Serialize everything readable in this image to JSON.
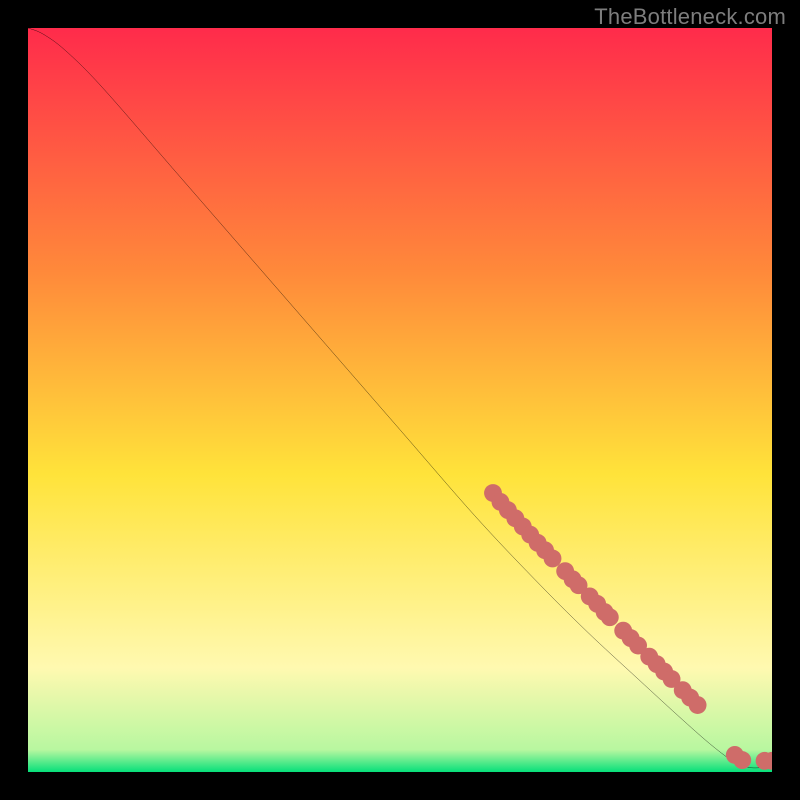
{
  "watermark": "TheBottleneck.com",
  "colors": {
    "bg": "#000000",
    "watermark": "#7d7d7d",
    "line": "#000000",
    "point_fill": "#cf6c69",
    "gradient_top": "#ff2b4b",
    "gradient_mid_upper": "#ff8a3a",
    "gradient_mid": "#ffe33a",
    "gradient_lower": "#fff9b0",
    "gradient_bottom": "#06e07a"
  },
  "chart_data": {
    "type": "line",
    "title": "",
    "xlabel": "",
    "ylabel": "",
    "xlim": [
      0,
      100
    ],
    "ylim": [
      0,
      100
    ],
    "grid": false,
    "legend": null,
    "line_points": [
      [
        0.0,
        100.0
      ],
      [
        2.0,
        99.2
      ],
      [
        5.0,
        97.0
      ],
      [
        10.0,
        92.0
      ],
      [
        20.0,
        80.5
      ],
      [
        30.0,
        69.0
      ],
      [
        40.0,
        57.5
      ],
      [
        50.0,
        46.0
      ],
      [
        60.0,
        34.5
      ],
      [
        68.0,
        26.0
      ],
      [
        75.0,
        19.0
      ],
      [
        82.0,
        12.5
      ],
      [
        88.0,
        7.0
      ],
      [
        92.0,
        3.5
      ],
      [
        95.0,
        1.3
      ],
      [
        97.0,
        0.6
      ],
      [
        99.0,
        0.6
      ],
      [
        100.0,
        0.6
      ]
    ],
    "scatter_points": [
      [
        62.5,
        37.5
      ],
      [
        63.5,
        36.3
      ],
      [
        64.5,
        35.2
      ],
      [
        65.5,
        34.1
      ],
      [
        66.5,
        33.0
      ],
      [
        67.5,
        31.9
      ],
      [
        68.5,
        30.8
      ],
      [
        69.5,
        29.8
      ],
      [
        70.5,
        28.7
      ],
      [
        72.2,
        27.0
      ],
      [
        73.2,
        25.9
      ],
      [
        74.0,
        25.1
      ],
      [
        75.5,
        23.6
      ],
      [
        76.5,
        22.6
      ],
      [
        77.5,
        21.5
      ],
      [
        78.2,
        20.8
      ],
      [
        80.0,
        19.0
      ],
      [
        81.0,
        18.0
      ],
      [
        82.0,
        17.0
      ],
      [
        83.5,
        15.5
      ],
      [
        84.5,
        14.5
      ],
      [
        85.5,
        13.5
      ],
      [
        86.5,
        12.5
      ],
      [
        88.0,
        11.0
      ],
      [
        89.0,
        10.0
      ],
      [
        90.0,
        9.0
      ],
      [
        95.0,
        2.3
      ],
      [
        96.0,
        1.6
      ],
      [
        99.0,
        1.5
      ],
      [
        100.0,
        1.5
      ]
    ],
    "point_radius": 1.2
  }
}
